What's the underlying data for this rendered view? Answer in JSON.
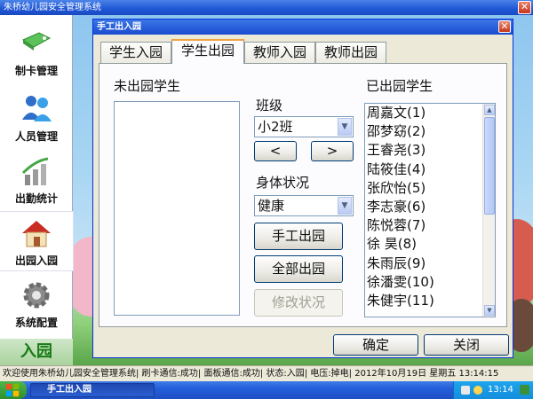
{
  "app": {
    "title": "朱桥幼儿园安全管理系统",
    "close_glyph": "✕"
  },
  "sidebar": {
    "items": [
      {
        "label": "制卡管理",
        "icon": "card-tag-icon"
      },
      {
        "label": "人员管理",
        "icon": "people-icon"
      },
      {
        "label": "出勤统计",
        "icon": "bar-chart-icon"
      },
      {
        "label": "出园入园",
        "icon": "house-icon"
      },
      {
        "label": "系统配置",
        "icon": "gear-icon"
      }
    ],
    "footer": "入园"
  },
  "dialog": {
    "title": "手工出入园",
    "close_glyph": "✕",
    "tabs": [
      {
        "label": "学生入园"
      },
      {
        "label": "学生出园"
      },
      {
        "label": "教师入园"
      },
      {
        "label": "教师出园"
      }
    ],
    "active_tab": "学生出园",
    "left_list_label": "未出园学生",
    "right_list_label": "已出园学生",
    "class_label": "班级",
    "class_value": "小2班",
    "prev_label": "<",
    "next_label": ">",
    "health_label": "身体状况",
    "health_value": "健康",
    "manual_exit_label": "手工出园",
    "all_exit_label": "全部出园",
    "modify_status_label": "修改状况",
    "exited_students": [
      "周嘉文(1)",
      "邵梦窈(2)",
      "王睿尧(3)",
      "陆筱佳(4)",
      "张欣怡(5)",
      "李志豪(6)",
      "陈悦蓉(7)",
      "徐  昊(8)",
      "朱雨辰(9)",
      "徐潘雯(10)",
      "朱健宇(11)"
    ],
    "ok_label": "确定",
    "close_label": "关闭"
  },
  "statusbar": {
    "text": "欢迎使用朱桥幼儿园安全管理系统| 刷卡通信:成功| 面板通信:成功| 状态:入园| 电压:掉电| 2012年10月19日 星期五 13:14:15"
  },
  "taskbar": {
    "task_label": "手工出入园",
    "time": "13:14"
  },
  "colors": {
    "titlebar": "#1f56d6",
    "dialog_bg": "#ece9d8",
    "sidebar_footer_text": "#177a15",
    "tab_highlight": "#f0a33c"
  }
}
